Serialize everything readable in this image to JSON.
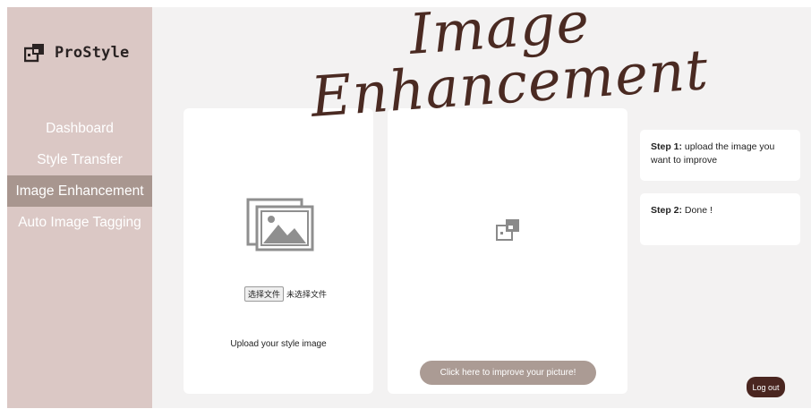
{
  "brand": {
    "name": "ProStyle",
    "logo_icon": "stacked-squares-logo-icon"
  },
  "sidebar": {
    "items": [
      {
        "label": "Dashboard",
        "active": false
      },
      {
        "label": "Style Transfer",
        "active": false
      },
      {
        "label": "Image Enhancement",
        "active": true
      },
      {
        "label": "Auto Image Tagging",
        "active": false
      }
    ]
  },
  "header": {
    "title_line_1": "Image",
    "title_line_2": "Enhancement"
  },
  "upload_panel": {
    "icon": "image-gallery-icon",
    "file_button_label": "选择文件",
    "file_status": "未选择文件",
    "caption": "Upload your style image"
  },
  "result_panel": {
    "placeholder_icon": "stacked-squares-icon",
    "improve_button_label": "Click here to improve your picture!"
  },
  "steps": [
    {
      "label": "Step 1:",
      "text": " upload the image you want to improve"
    },
    {
      "label": "Step 2:",
      "text": " Done !"
    }
  ],
  "logout": {
    "label": "Log out"
  },
  "colors": {
    "sidebar_bg": "#dbc8c5",
    "sidebar_active": "#a8968f",
    "main_bg": "#f3f2f2",
    "title_color": "#4a2a22",
    "button_bg": "#ab9b94",
    "logout_bg": "#4a2620"
  }
}
